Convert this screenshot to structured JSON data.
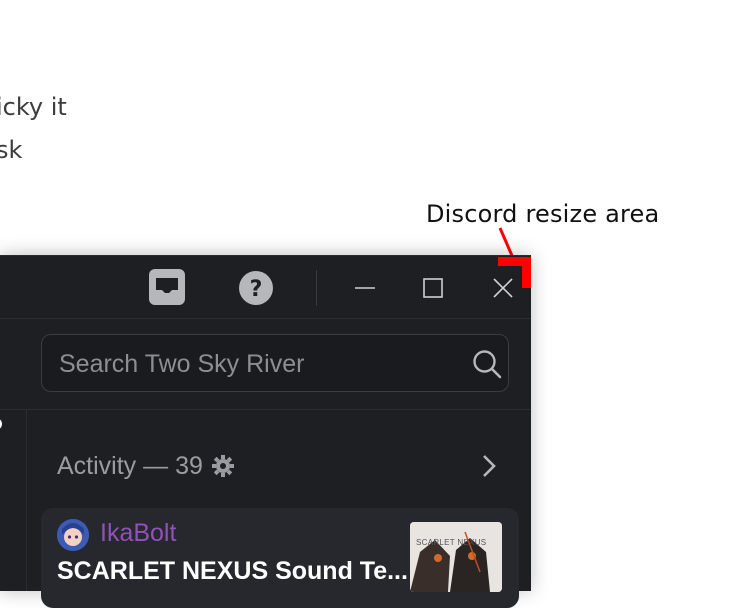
{
  "background_text": {
    "line1": "icky it",
    "line2": "sk"
  },
  "annotation": {
    "label": "Discord resize area",
    "marker_color": "#ff0000"
  },
  "titlebar": {
    "icons": [
      "inbox-icon",
      "help-icon"
    ],
    "window_controls": [
      "minimize-icon",
      "maximize-icon",
      "close-icon"
    ]
  },
  "search": {
    "placeholder": "Search Two Sky River",
    "value": "",
    "icon": "search-icon"
  },
  "activity": {
    "header": "Activity — 39",
    "settings_icon": "gear-icon",
    "expand_icon": "chevron-right-icon"
  },
  "activity_card": {
    "username": "IkaBolt",
    "username_color": "#8e52b8",
    "track": "SCARLET NEXUS Sound Te...",
    "album_caption": "SCARLET NEXUS"
  },
  "colors": {
    "window_bg": "#1e1f22",
    "card_bg": "#27282d",
    "page_bg": "#ffffff"
  }
}
